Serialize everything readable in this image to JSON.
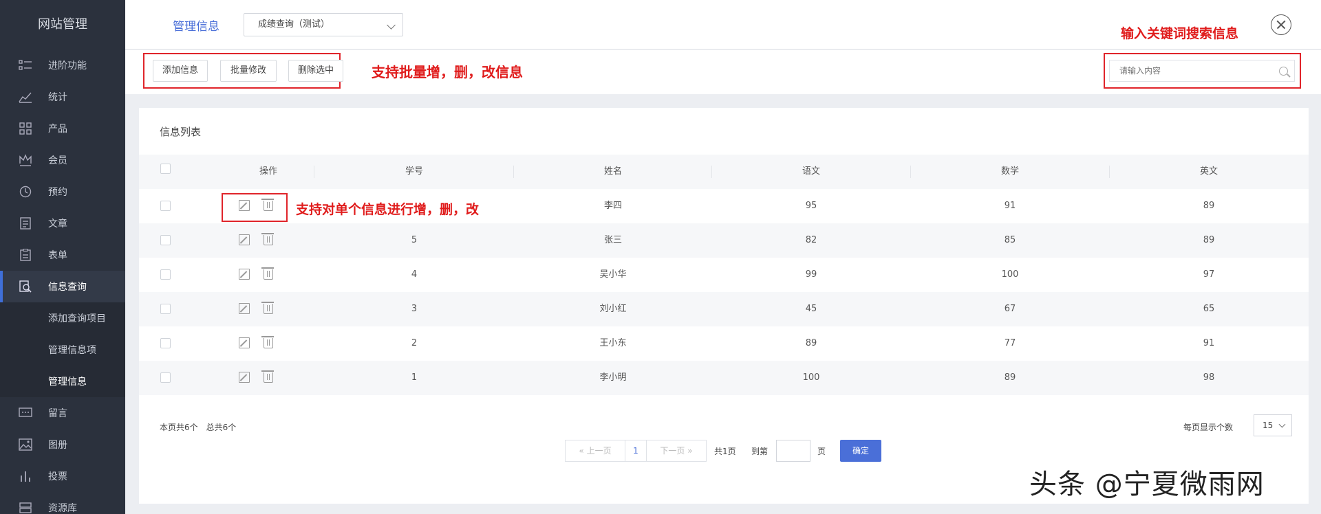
{
  "sidebar": {
    "title": "网站管理",
    "items": [
      {
        "label": "进阶功能",
        "icon": "list-icon"
      },
      {
        "label": "统计",
        "icon": "chart-icon"
      },
      {
        "label": "产品",
        "icon": "grid-icon"
      },
      {
        "label": "会员",
        "icon": "crown-icon"
      },
      {
        "label": "预约",
        "icon": "clock-icon"
      },
      {
        "label": "文章",
        "icon": "document-icon"
      },
      {
        "label": "表单",
        "icon": "clipboard-icon"
      },
      {
        "label": "信息查询",
        "icon": "search-doc-icon"
      }
    ],
    "subitems": [
      "添加查询项目",
      "管理信息项",
      "管理信息"
    ],
    "items_after": [
      {
        "label": "留言",
        "icon": "message-icon"
      },
      {
        "label": "图册",
        "icon": "image-icon"
      },
      {
        "label": "投票",
        "icon": "bar-icon"
      },
      {
        "label": "资源库",
        "icon": "storage-icon"
      }
    ]
  },
  "topbar": {
    "title": "管理信息",
    "select_value": "成绩查询（测试）"
  },
  "annotations": {
    "search": "输入关键词搜索信息",
    "batch": "支持批量增，删，改信息",
    "row": "支持对单个信息进行增，删，改"
  },
  "toolbar": {
    "add_label": "添加信息",
    "batch_edit_label": "批量修改",
    "delete_selected_label": "删除选中",
    "search_placeholder": "请输入内容"
  },
  "card": {
    "title": "信息列表",
    "columns": [
      "操作",
      "学号",
      "姓名",
      "语文",
      "数学",
      "英文"
    ],
    "rows": [
      {
        "id": "",
        "name": "李四",
        "chinese": "95",
        "math": "91",
        "english": "89"
      },
      {
        "id": "5",
        "name": "张三",
        "chinese": "82",
        "math": "85",
        "english": "89"
      },
      {
        "id": "4",
        "name": "吴小华",
        "chinese": "99",
        "math": "100",
        "english": "97"
      },
      {
        "id": "3",
        "name": "刘小红",
        "chinese": "45",
        "math": "67",
        "english": "65"
      },
      {
        "id": "2",
        "name": "王小东",
        "chinese": "89",
        "math": "77",
        "english": "91"
      },
      {
        "id": "1",
        "name": "李小明",
        "chinese": "100",
        "math": "89",
        "english": "98"
      }
    ]
  },
  "pagination": {
    "count_text": "本页共6个　总共6个",
    "per_page_label": "每页显示个数",
    "per_page_value": "15",
    "prev_label": "« 上一页",
    "current_page": "1",
    "next_label": "下一页 »",
    "total_pages": "共1页",
    "goto_label": "到第",
    "page_suffix": "页",
    "confirm_label": "确定"
  },
  "watermark": "头条 @宁夏微雨网"
}
